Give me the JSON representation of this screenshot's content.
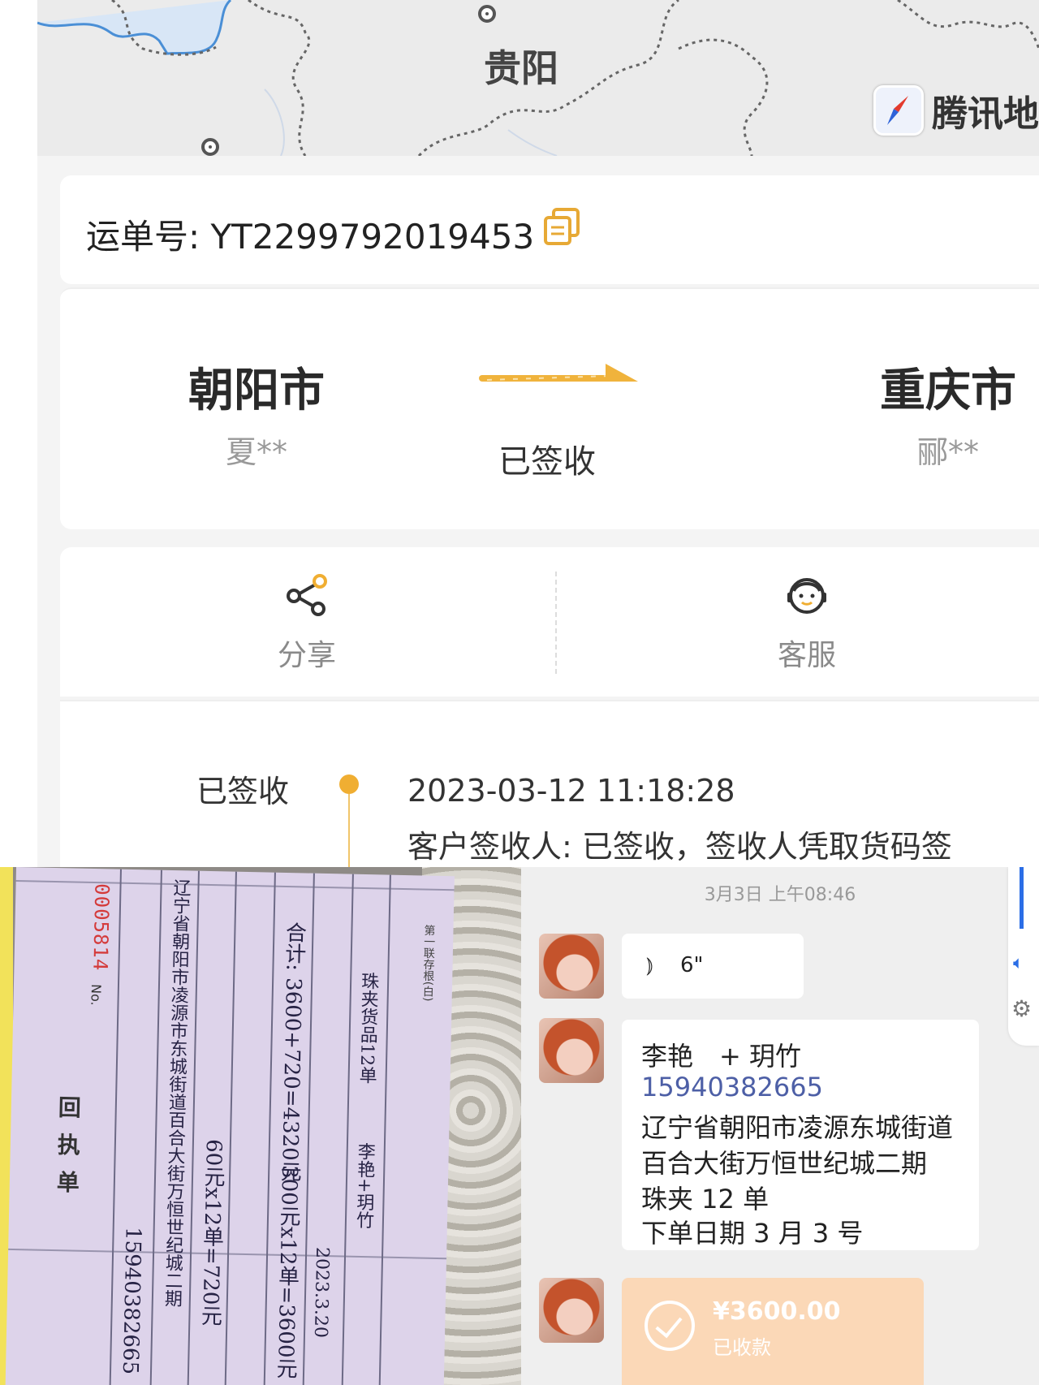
{
  "map": {
    "city_label": "贵阳",
    "provider": "腾讯地图"
  },
  "waybill": {
    "label": "运单号: YT2299792019453"
  },
  "route": {
    "origin_city": "朝阳市",
    "origin_person": "夏**",
    "status": "已签收",
    "dest_city": "重庆市",
    "dest_person": "郦**"
  },
  "actions": {
    "share_label": "分享",
    "service_label": "客服"
  },
  "tracking": {
    "status": "已签收",
    "time": "2023-03-12 11:18:28",
    "desc": "客户签收人: 已签收，签收人凭取货码签"
  },
  "receipt": {
    "number": "0005814",
    "no_label": "No.",
    "title": "回执单",
    "line1": "15940382665",
    "line2": "辽宁省朝阳市凌源市东城街道百合大街万恒世纪城二期",
    "line3": "60元x12单=720元",
    "line4": "300元x12单=3600元",
    "line5": "合计: 3600+720=4320元",
    "line6": "2023.3.20",
    "line7": "李艳+玥竹",
    "line8": "珠夹货品12单",
    "footer_label": "第一联存根(白)"
  },
  "chat": {
    "time": "3月3日 上午08:46",
    "voice_length": "6\"",
    "msg_name": "李艳　+ 玥竹",
    "msg_phone": "15940382665",
    "msg_addr1": "辽宁省朝阳市凌源东城街道",
    "msg_addr2": "百合大街万恒世纪城二期",
    "msg_item": "珠夹 12 单",
    "msg_date": "下单日期 3 月 3 号",
    "pay_amount": "¥3600.00",
    "pay_status": "已收款"
  }
}
